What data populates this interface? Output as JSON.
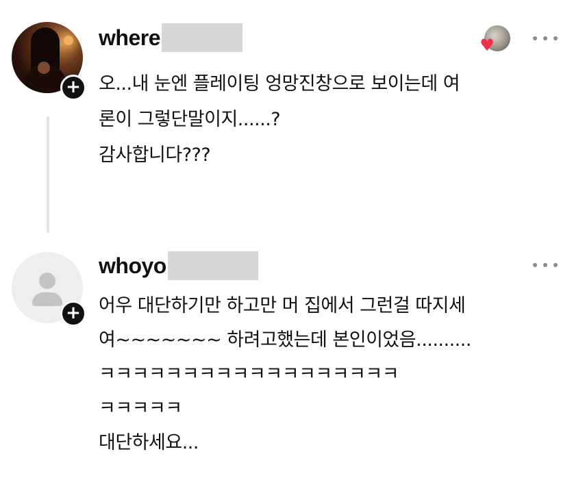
{
  "comments": [
    {
      "username": "where",
      "avatar_icon": "profile-photo",
      "follow_icon": "plus-icon",
      "liked_by_creator": true,
      "lines": [
        "오...내 눈엔 플레이팅 엉망진창으로 보이는데 여",
        "론이 그렇단말이지......?",
        "감사합니다???"
      ]
    },
    {
      "username": "whoyo",
      "avatar_icon": "default-user-icon",
      "follow_icon": "plus-icon",
      "liked_by_creator": false,
      "lines": [
        "어우 대단하기만 하고만 머 집에서 그런걸 따지세",
        "여~~~~~~~ 하려고했는데 본인이었음..........",
        "ㅋㅋㅋㅋㅋㅋㅋㅋㅋㅋㅋㅋㅋㅋㅋㅋㅋㅋ",
        "ㅋㅋㅋㅋㅋ",
        "대단하세요..."
      ]
    }
  ],
  "icons": {
    "follow_badge": "+",
    "heart": "♥",
    "more": "more-horizontal-icon"
  },
  "colors": {
    "text": "#111111",
    "heart": "#ef2e4a",
    "redaction": "#d6d6d6",
    "thread_line": "#e3e3e3",
    "more_dots": "#8a8a8a"
  }
}
